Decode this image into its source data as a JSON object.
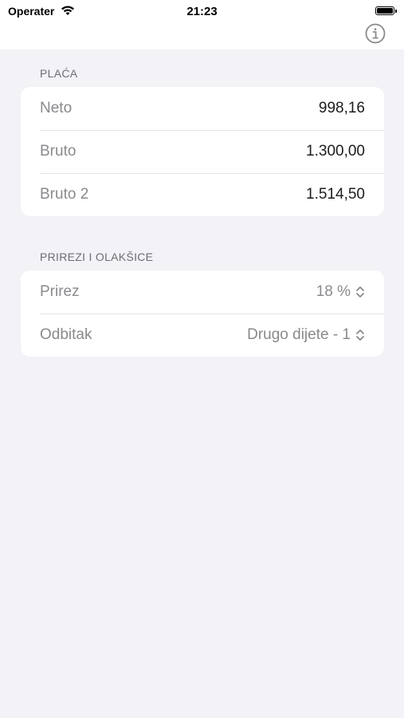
{
  "status_bar": {
    "carrier": "Operater",
    "time": "21:23"
  },
  "nav": {
    "info_icon": "info-circle-icon"
  },
  "sections": {
    "salary": {
      "header": "PLAĆA",
      "rows": [
        {
          "label": "Neto",
          "value": "998,16"
        },
        {
          "label": "Bruto",
          "value": "1.300,00"
        },
        {
          "label": "Bruto 2",
          "value": "1.514,50"
        }
      ]
    },
    "surcharges": {
      "header": "PRIREZI I OLAKŠICE",
      "rows": [
        {
          "label": "Prirez",
          "value": "18 %"
        },
        {
          "label": "Odbitak",
          "value": "Drugo dijete - 1"
        }
      ]
    }
  },
  "colors": {
    "background": "#f2f2f7",
    "card": "#ffffff",
    "secondary_text": "#8a8a8e",
    "accent": "#8a8a8e"
  }
}
